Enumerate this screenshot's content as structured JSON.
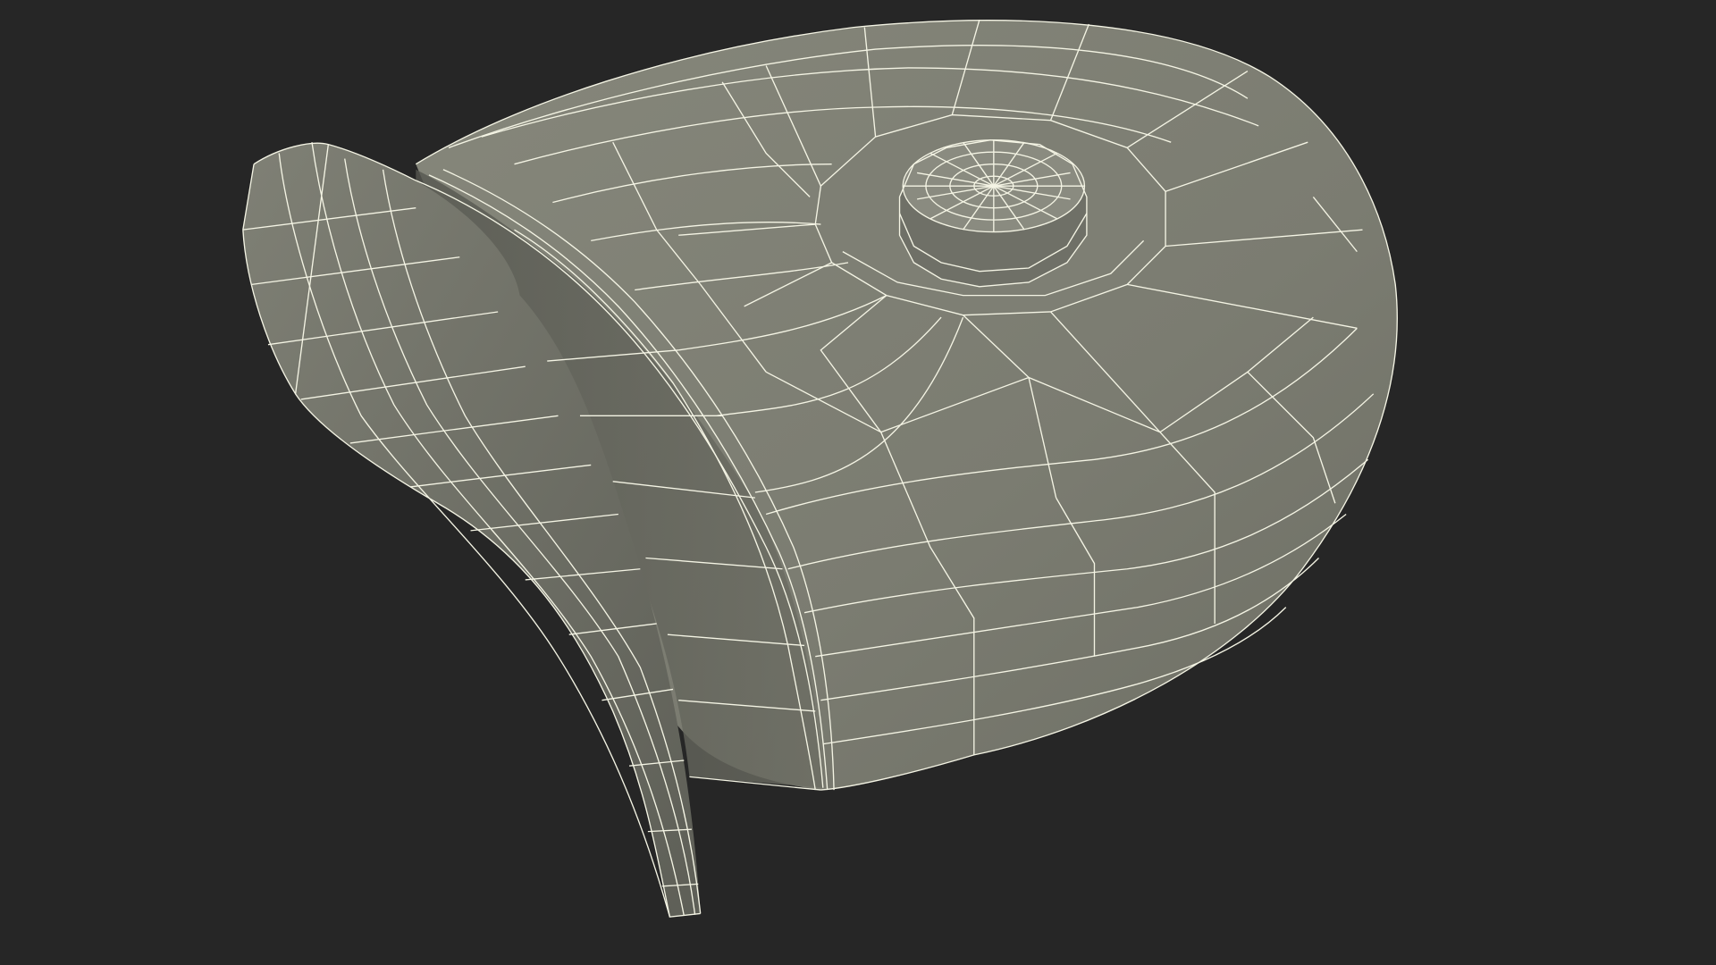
{
  "scene": {
    "subject": "wireframe-3d-model",
    "colors": {
      "background": "#262626",
      "surface_light": "#8a8a7e",
      "surface_mid": "#7a7b70",
      "surface_dark": "#5c5d55",
      "wire": "#f4f4e4"
    }
  }
}
